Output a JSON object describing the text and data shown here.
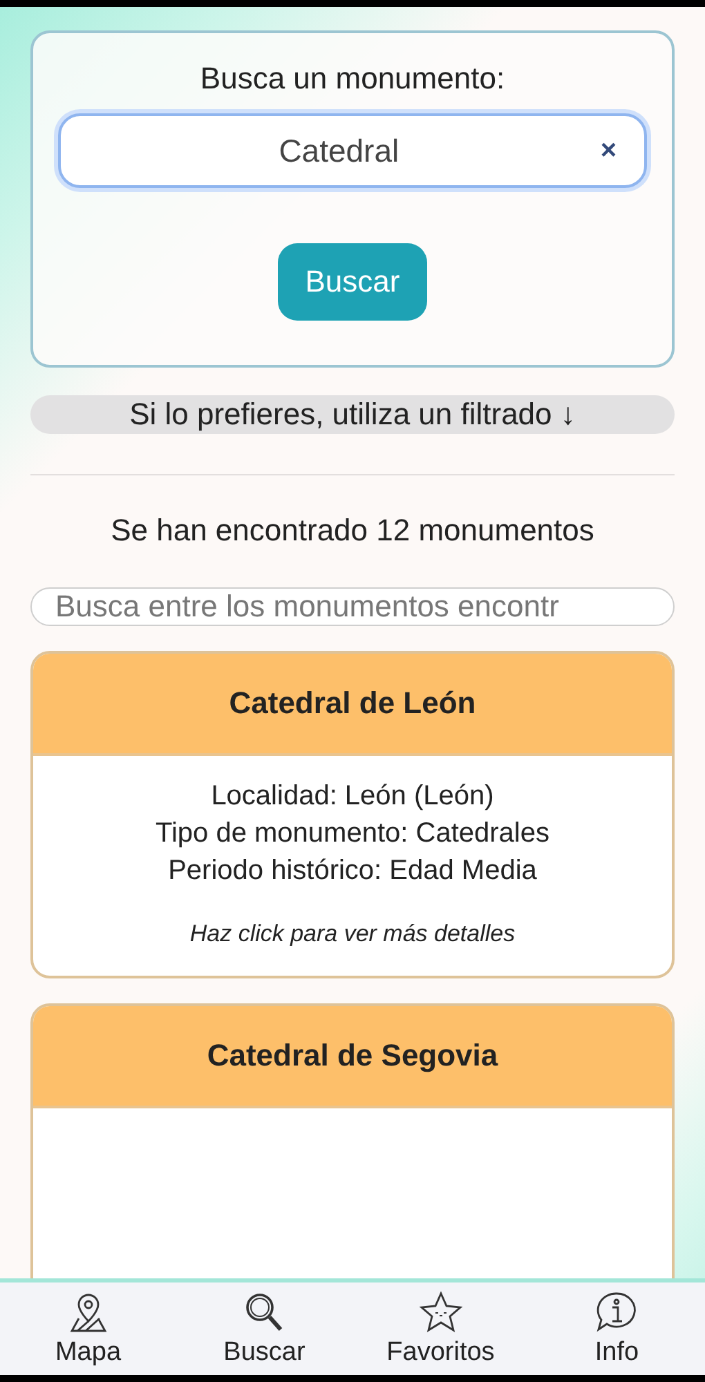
{
  "search": {
    "title": "Busca un monumento:",
    "value": "Catedral",
    "clear": "×",
    "button": "Buscar"
  },
  "filter_button": {
    "label": "Si lo prefieres, utiliza un filtrado ↓"
  },
  "results_count": "Se han encontrado 12 monumentos",
  "results_search": {
    "placeholder": "Busca entre los monumentos encontr"
  },
  "monuments": [
    {
      "name": "Catedral de León",
      "details": [
        "Localidad: León (León)",
        "Tipo de monumento: Catedrales",
        "Periodo histórico: Edad Media"
      ],
      "hint": "Haz click para ver más detalles"
    },
    {
      "name": "Catedral de Segovia"
    }
  ],
  "nav": [
    {
      "kind": "map",
      "label": "Mapa"
    },
    {
      "kind": "search",
      "label": "Buscar"
    },
    {
      "kind": "star",
      "label": "Favoritos"
    },
    {
      "kind": "info",
      "label": "Info"
    }
  ]
}
